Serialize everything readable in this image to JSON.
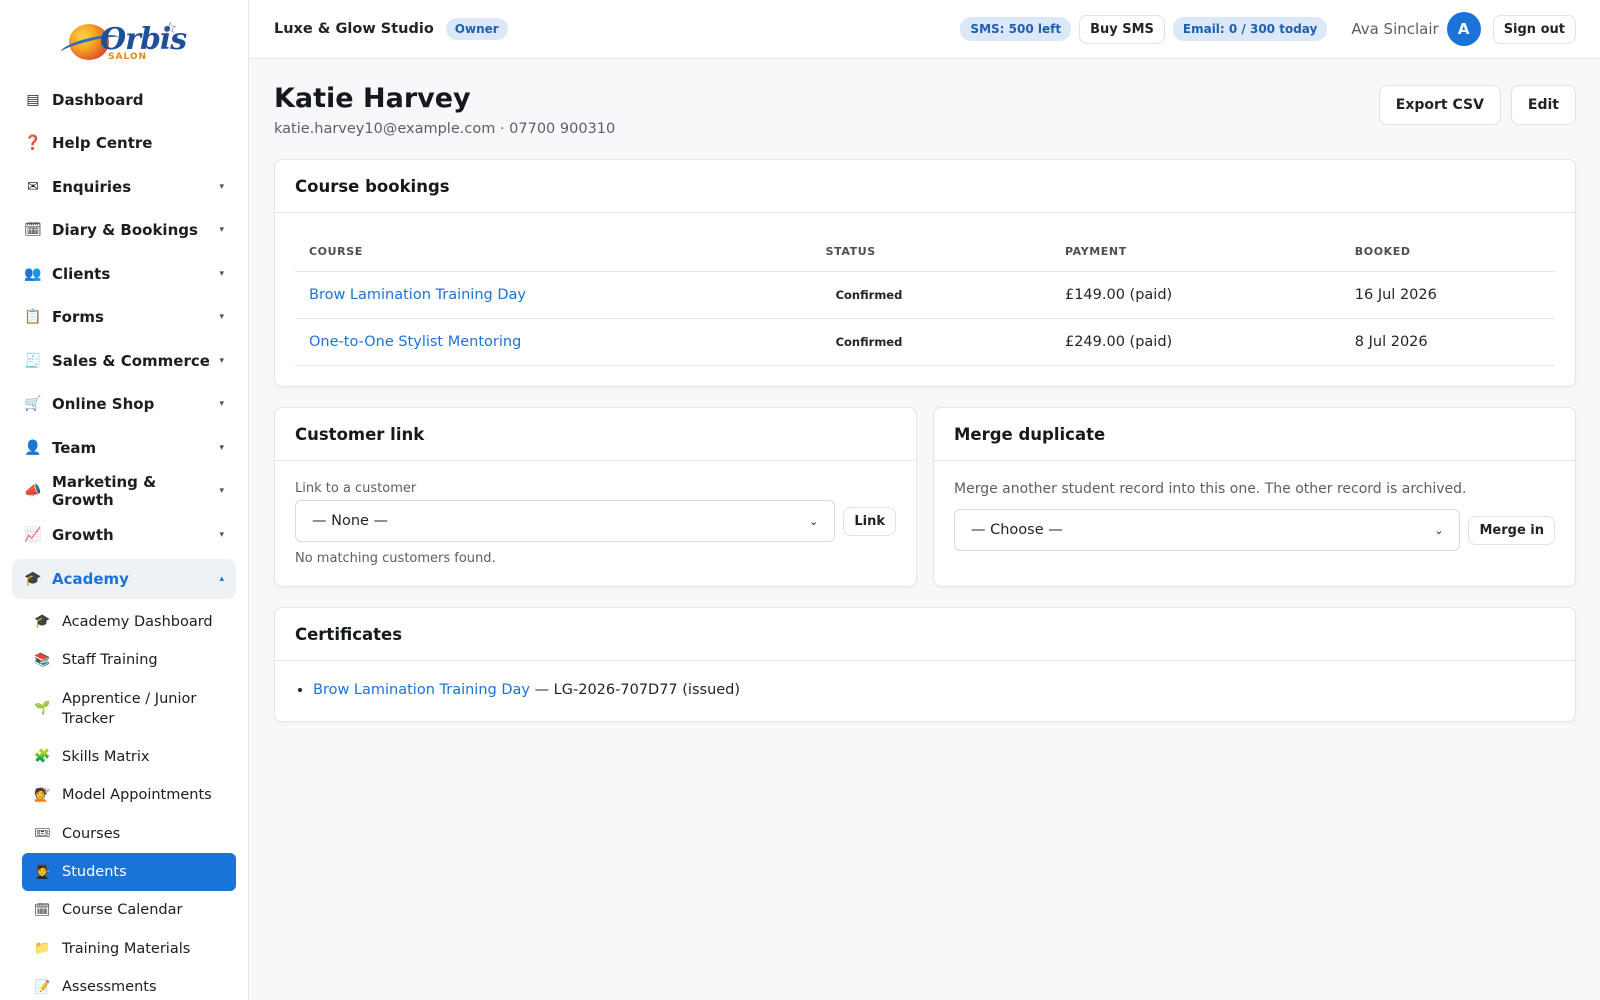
{
  "logo": {
    "word": "Orbis",
    "sub": "SALON"
  },
  "sidebar": {
    "items": [
      {
        "icon": "▤",
        "label": "Dashboard",
        "chev": ""
      },
      {
        "icon": "❓",
        "label": "Help Centre",
        "chev": ""
      },
      {
        "icon": "✉",
        "label": "Enquiries",
        "chev": "▾"
      },
      {
        "icon": "🗓",
        "label": "Diary & Bookings",
        "chev": "▾"
      },
      {
        "icon": "👥",
        "label": "Clients",
        "chev": "▾"
      },
      {
        "icon": "📋",
        "label": "Forms",
        "chev": "▾"
      },
      {
        "icon": "🧾",
        "label": "Sales & Commerce",
        "chev": "▾"
      },
      {
        "icon": "🛒",
        "label": "Online Shop",
        "chev": "▾"
      },
      {
        "icon": "👤",
        "label": "Team",
        "chev": "▾"
      },
      {
        "icon": "📣",
        "label": "Marketing & Growth",
        "chev": "▾"
      },
      {
        "icon": "📈",
        "label": "Growth",
        "chev": "▾"
      }
    ],
    "academy": {
      "icon": "🎓",
      "label": "Academy",
      "chev": "▴"
    },
    "sub_items": [
      {
        "icon": "🎓",
        "label": "Academy Dashboard"
      },
      {
        "icon": "📚",
        "label": "Staff Training"
      },
      {
        "icon": "🌱",
        "label": "Apprentice / Junior Tracker"
      },
      {
        "icon": "🧩",
        "label": "Skills Matrix"
      },
      {
        "icon": "💇",
        "label": "Model Appointments"
      },
      {
        "icon": "🎟",
        "label": "Courses"
      },
      {
        "icon": "🧑‍🎓",
        "label": "Students"
      },
      {
        "icon": "🗓",
        "label": "Course Calendar"
      },
      {
        "icon": "📁",
        "label": "Training Materials"
      },
      {
        "icon": "📝",
        "label": "Assessments"
      }
    ]
  },
  "topbar": {
    "studio": "Luxe & Glow Studio",
    "role": "Owner",
    "sms": "SMS: 500 left",
    "buy_sms": "Buy SMS",
    "email": "Email: 0 / 300 today",
    "user": "Ava Sinclair",
    "avatar": "A",
    "signout": "Sign out"
  },
  "student": {
    "name": "Katie Harvey",
    "contact": "katie.harvey10@example.com · 07700 900310",
    "export": "Export CSV",
    "edit": "Edit"
  },
  "bookings": {
    "title": "Course bookings",
    "headers": [
      "COURSE",
      "STATUS",
      "PAYMENT",
      "BOOKED"
    ],
    "rows": [
      {
        "course": "Brow Lamination Training Day",
        "status": "Confirmed",
        "payment": "£149.00 (paid)",
        "booked": "16 Jul 2026"
      },
      {
        "course": "One-to-One Stylist Mentoring",
        "status": "Confirmed",
        "payment": "£249.00 (paid)",
        "booked": "8 Jul 2026"
      }
    ]
  },
  "customer_link": {
    "title": "Customer link",
    "label": "Link to a customer",
    "selected": "— None —",
    "button": "Link",
    "note": "No matching customers found."
  },
  "merge": {
    "title": "Merge duplicate",
    "help": "Merge another student record into this one. The other record is archived.",
    "selected": "— Choose —",
    "button": "Merge in"
  },
  "certificates": {
    "title": "Certificates",
    "items": [
      {
        "course": "Brow Lamination Training Day",
        "detail": " — LG-2026-707D77 (issued)"
      }
    ]
  }
}
